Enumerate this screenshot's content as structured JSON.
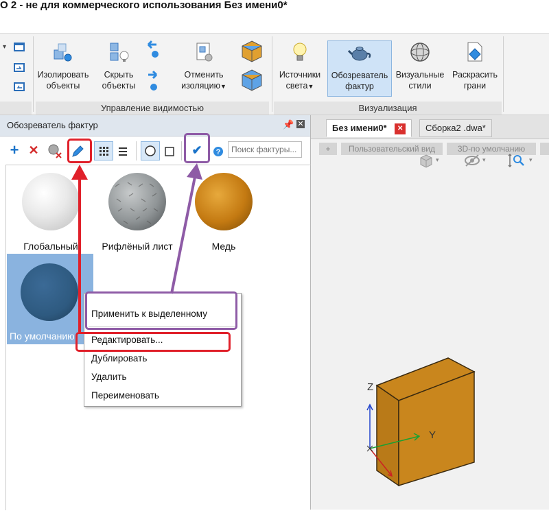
{
  "window": {
    "title": "О 2 - не для коммерческого использования Без имени0*"
  },
  "ribbon": {
    "visibility_panel": {
      "title": "Управление видимостью",
      "buttons": [
        {
          "label_line1": "Изолировать",
          "label_line2": "объекты"
        },
        {
          "label_line1": "Скрыть",
          "label_line2": "объекты"
        },
        {
          "label_line1": "Отменить",
          "label_line2": "изоляцию"
        }
      ]
    },
    "visualization_panel": {
      "title": "Визуализация",
      "buttons": [
        {
          "label_line1": "Источники",
          "label_line2": "света"
        },
        {
          "label_line1": "Обозреватель",
          "label_line2": "фактур"
        },
        {
          "label_line1": "Визуальные",
          "label_line2": "стили"
        },
        {
          "label_line1": "Раскрасить",
          "label_line2": "грани"
        }
      ]
    }
  },
  "texture_browser": {
    "title": "Обозреватель фактур",
    "search_placeholder": "Поиск фактуры...",
    "materials": [
      {
        "name": "Глобальный"
      },
      {
        "name": "Рифлёный лист"
      },
      {
        "name": "Медь"
      },
      {
        "name": "По умолчанию",
        "selected": true
      }
    ]
  },
  "context_menu": {
    "items": [
      "Применить к выделенному",
      "Редактировать...",
      "Дублировать",
      "Удалить",
      "Переименовать"
    ]
  },
  "viewport": {
    "tabs": [
      {
        "label": "Без имени0*",
        "active": true
      },
      {
        "label": "Сборка2 .dwa*",
        "active": false
      }
    ],
    "view_controls": [
      "+",
      "Пользовательский вид",
      "3D-по умолчанию"
    ],
    "axes": {
      "z": "Z",
      "y": "Y"
    }
  },
  "colors": {
    "accent": "#1a73c9",
    "annotation_red": "#e0202a",
    "annotation_purple": "#8e5ba6",
    "cube_face": "#c9861d",
    "sphere_default": "#2e5a80"
  }
}
